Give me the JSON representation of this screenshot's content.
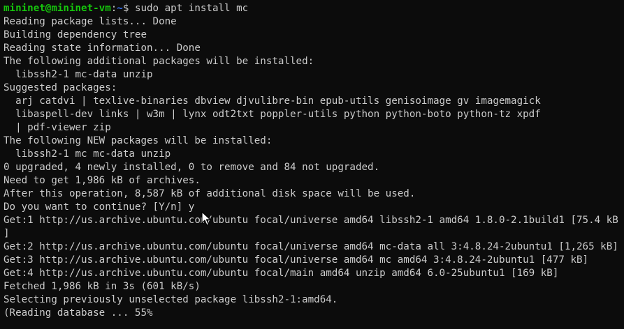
{
  "prompt": {
    "user_host": "mininet@mininet-vm",
    "separator": ":",
    "path": "~",
    "symbol": "$ ",
    "command": "sudo apt install mc"
  },
  "output_lines": [
    "Reading package lists... Done",
    "Building dependency tree",
    "Reading state information... Done",
    "The following additional packages will be installed:",
    "  libssh2-1 mc-data unzip",
    "Suggested packages:",
    "  arj catdvi | texlive-binaries dbview djvulibre-bin epub-utils genisoimage gv imagemagick",
    "  libaspell-dev links | w3m | lynx odt2txt poppler-utils python python-boto python-tz xpdf",
    "  | pdf-viewer zip",
    "The following NEW packages will be installed:",
    "  libssh2-1 mc mc-data unzip",
    "0 upgraded, 4 newly installed, 0 to remove and 84 not upgraded.",
    "Need to get 1,986 kB of archives.",
    "After this operation, 8,587 kB of additional disk space will be used.",
    "Do you want to continue? [Y/n] y",
    "Get:1 http://us.archive.ubuntu.com/ubuntu focal/universe amd64 libssh2-1 amd64 1.8.0-2.1build1 [75.4 kB",
    "]",
    "Get:2 http://us.archive.ubuntu.com/ubuntu focal/universe amd64 mc-data all 3:4.8.24-2ubuntu1 [1,265 kB]",
    "Get:3 http://us.archive.ubuntu.com/ubuntu focal/universe amd64 mc amd64 3:4.8.24-2ubuntu1 [477 kB]",
    "Get:4 http://us.archive.ubuntu.com/ubuntu focal/main amd64 unzip amd64 6.0-25ubuntu1 [169 kB]",
    "Fetched 1,986 kB in 3s (601 kB/s)",
    "Selecting previously unselected package libssh2-1:amd64.",
    "(Reading database ... 55%"
  ],
  "colors": {
    "background": "#0c0c0c",
    "text": "#cccccc",
    "user_host": "#16c60c",
    "path": "#3b78ff"
  },
  "icons": {
    "mouse_pointer": "mouse-pointer-icon"
  }
}
